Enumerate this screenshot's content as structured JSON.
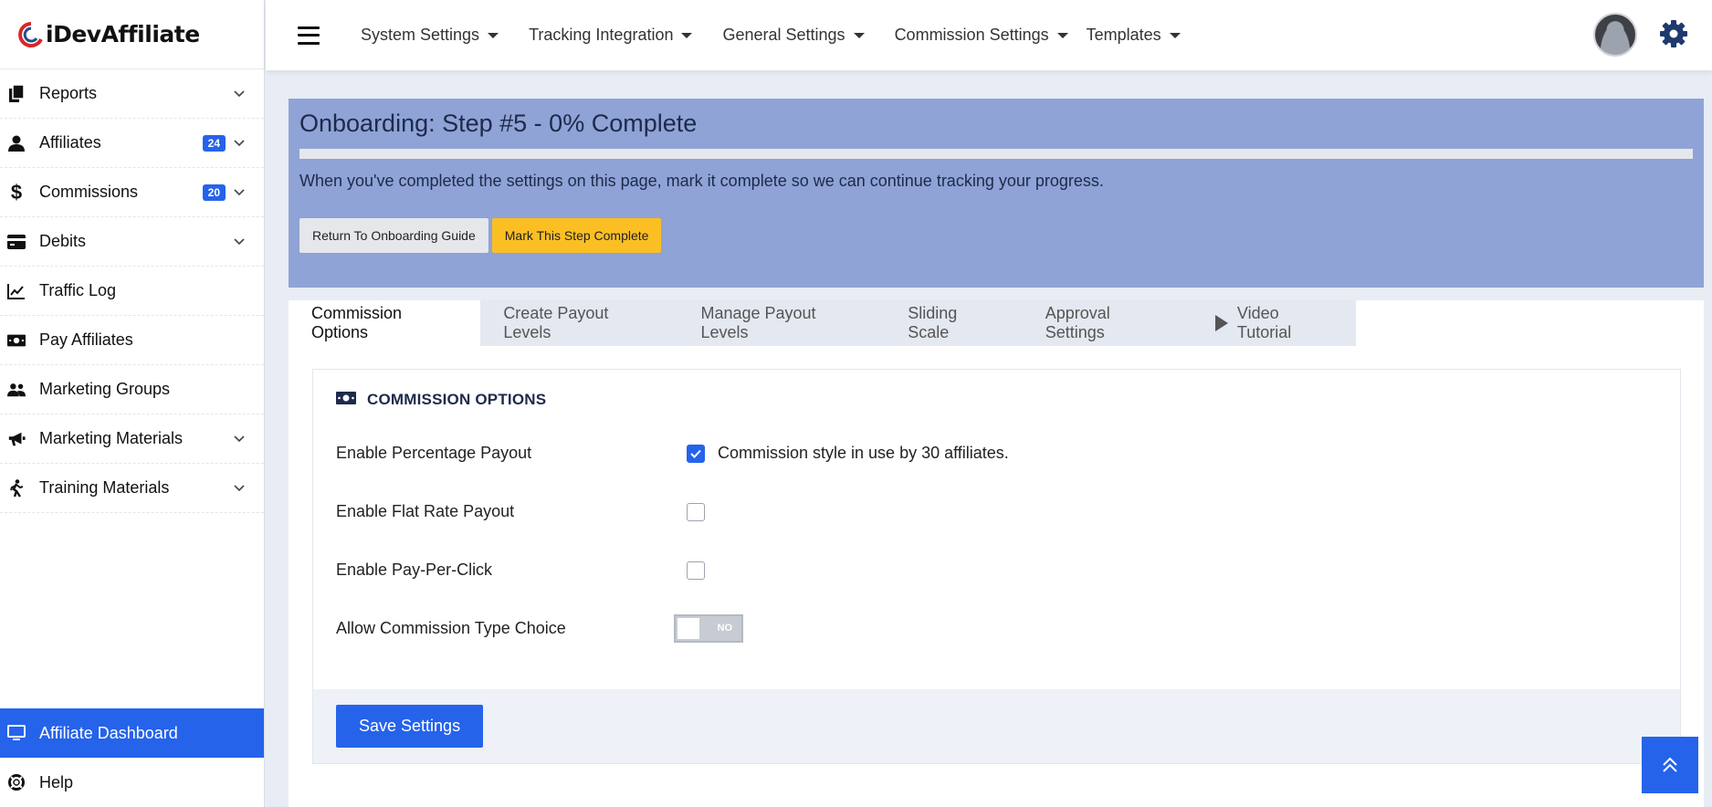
{
  "brand": {
    "name": "iDevAffiliate"
  },
  "sidebar": {
    "items": [
      {
        "label": "Reports",
        "icon": "document-copy-icon",
        "badge": "",
        "expandable": true
      },
      {
        "label": "Affiliates",
        "icon": "user-icon",
        "badge": "24",
        "expandable": true
      },
      {
        "label": "Commissions",
        "icon": "dollar-icon",
        "badge": "20",
        "expandable": true
      },
      {
        "label": "Debits",
        "icon": "credit-card-icon",
        "badge": "",
        "expandable": true
      },
      {
        "label": "Traffic Log",
        "icon": "line-chart-icon",
        "badge": "",
        "expandable": false
      },
      {
        "label": "Pay Affiliates",
        "icon": "money-bill-icon",
        "badge": "",
        "expandable": false
      },
      {
        "label": "Marketing Groups",
        "icon": "users-icon",
        "badge": "",
        "expandable": false
      },
      {
        "label": "Marketing Materials",
        "icon": "megaphone-icon",
        "badge": "",
        "expandable": true
      },
      {
        "label": "Training Materials",
        "icon": "walking-person-icon",
        "badge": "",
        "expandable": true
      }
    ],
    "bottom": [
      {
        "label": "Affiliate Dashboard",
        "icon": "monitor-icon",
        "active": true
      },
      {
        "label": "Help",
        "icon": "lifebuoy-icon",
        "active": false
      }
    ]
  },
  "topbar": {
    "menu": [
      "System Settings",
      "Tracking Integration",
      "General Settings",
      "Commission Settings",
      "Templates"
    ]
  },
  "onboarding": {
    "title": "Onboarding: Step #5 - 0% Complete",
    "progress_percent": 0,
    "text": "When you've completed the settings on this page, mark it complete so we can continue tracking your progress.",
    "return_button": "Return To Onboarding Guide",
    "complete_button": "Mark This Step Complete"
  },
  "tabs": [
    "Commission Options",
    "Create Payout Levels",
    "Manage Payout Levels",
    "Sliding Scale",
    "Approval Settings",
    "Video Tutorial"
  ],
  "panel": {
    "title": "COMMISSION OPTIONS",
    "rows": [
      {
        "label": "Enable Percentage Payout",
        "checked": true,
        "note": "Commission style in use by 30 affiliates."
      },
      {
        "label": "Enable Flat Rate Payout",
        "checked": false,
        "note": ""
      },
      {
        "label": "Enable Pay-Per-Click",
        "checked": false,
        "note": ""
      }
    ],
    "toggle_row": {
      "label": "Allow Commission Type Choice",
      "value": "NO"
    },
    "save_button": "Save Settings"
  },
  "colors": {
    "accent": "#2563eb",
    "onboarding_bg": "#8fa3d6",
    "warning": "#fbbf24"
  }
}
